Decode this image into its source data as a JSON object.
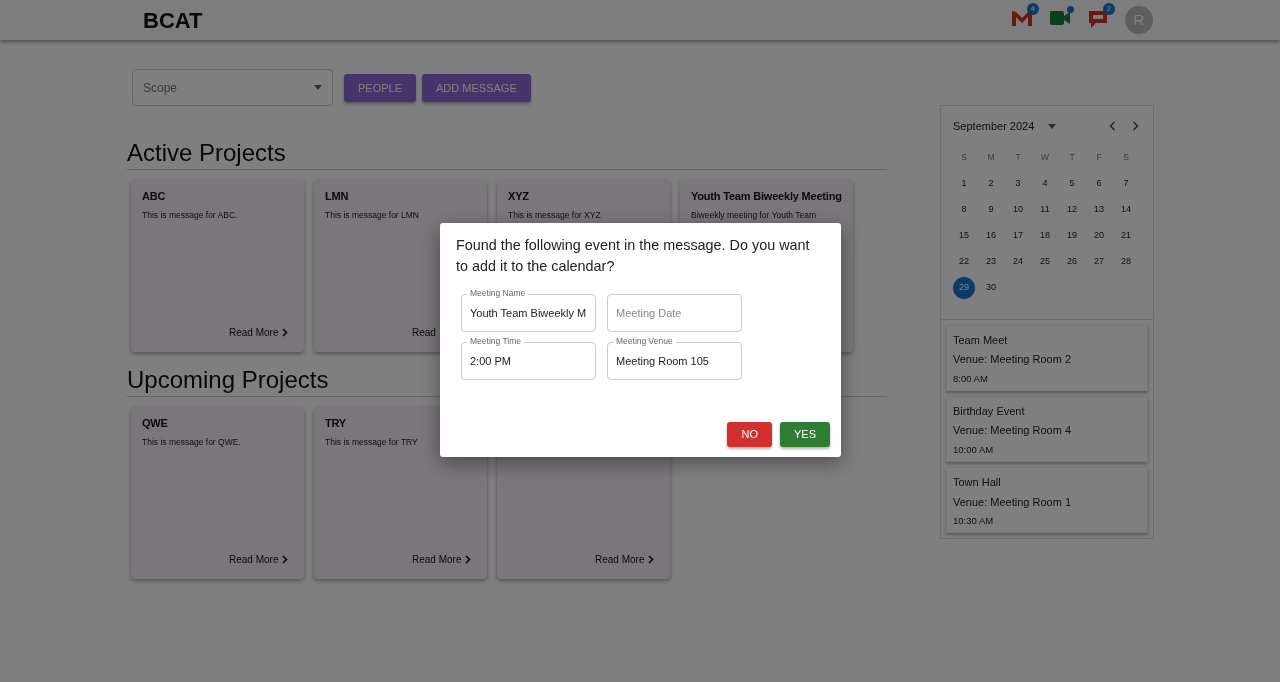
{
  "header": {
    "logo": "BCAT",
    "apps": [
      {
        "kind": "mail",
        "badge": "4"
      },
      {
        "kind": "video"
      },
      {
        "kind": "chat",
        "badge": "2"
      }
    ],
    "avatar": "R"
  },
  "toolbar": {
    "scope": {
      "placeholder": "Scope"
    },
    "buttons": [
      "PEOPLE",
      "ADD MESSAGE"
    ]
  },
  "sections": [
    {
      "title": "Active Projects",
      "cards": [
        {
          "title": "ABC",
          "body": "This is message for ABC.",
          "read_more": "Read More",
          "chevron": true
        },
        {
          "title": "LMN",
          "body": "This is message for LMN",
          "read_more": "Read",
          "chevron": false
        },
        {
          "title": "XYZ",
          "body": "This is message for XYZ"
        },
        {
          "title": "Youth Team Biweekly Meeting",
          "body": "Biweekly meeting for Youth Team"
        }
      ]
    },
    {
      "title": "Upcoming Projects",
      "cards": [
        {
          "title": "QWE",
          "body": "This is message for QWE.",
          "read_more": "Read More",
          "chevron": true
        },
        {
          "title": "TRY",
          "body": "This is message for TRY",
          "read_more": "Read More",
          "chevron": true
        },
        {
          "read_more": "Read More",
          "chevron": true
        }
      ]
    }
  ],
  "calendar": {
    "month": "September 2024",
    "weekdays": [
      "S",
      "M",
      "T",
      "W",
      "T",
      "F",
      "S"
    ],
    "days": [
      {
        "label": "1",
        "selected": false
      },
      {
        "label": "2",
        "selected": false
      },
      {
        "label": "3",
        "selected": false
      },
      {
        "label": "4",
        "selected": false
      },
      {
        "label": "5",
        "selected": false
      },
      {
        "label": "6",
        "selected": false
      },
      {
        "label": "7",
        "selected": false
      },
      {
        "label": "8",
        "selected": false
      },
      {
        "label": "9",
        "selected": false
      },
      {
        "label": "10",
        "selected": false
      },
      {
        "label": "11",
        "selected": false
      },
      {
        "label": "12",
        "selected": false
      },
      {
        "label": "13",
        "selected": false
      },
      {
        "label": "14",
        "selected": false
      },
      {
        "label": "15",
        "selected": false
      },
      {
        "label": "16",
        "selected": false
      },
      {
        "label": "17",
        "selected": false
      },
      {
        "label": "18",
        "selected": false
      },
      {
        "label": "19",
        "selected": false
      },
      {
        "label": "20",
        "selected": false
      },
      {
        "label": "21",
        "selected": false
      },
      {
        "label": "22",
        "selected": false
      },
      {
        "label": "23",
        "selected": false
      },
      {
        "label": "24",
        "selected": false
      },
      {
        "label": "25",
        "selected": false
      },
      {
        "label": "26",
        "selected": false
      },
      {
        "label": "27",
        "selected": false
      },
      {
        "label": "28",
        "selected": false
      },
      {
        "label": "29",
        "selected": true
      },
      {
        "label": "30",
        "selected": false
      }
    ]
  },
  "events": [
    {
      "title": "Team Meet",
      "venue": "Venue: Meeting Room 2",
      "time": "8:00 AM"
    },
    {
      "title": "Birthday Event",
      "venue": "Venue: Meeting Room 4",
      "time": "10:00 AM"
    },
    {
      "title": "Town Hall",
      "venue": "Venue: Meeting Room 1",
      "time": "10:30 AM"
    }
  ],
  "dialog": {
    "message": "Found the following event in the message. Do you want to add it to the calendar?",
    "fields": [
      {
        "label": "Meeting Name",
        "value": "Youth Team Biweekly M"
      },
      {
        "placeholder": "Meeting Date"
      },
      {
        "label": "Meeting Time",
        "value": "2:00 PM"
      },
      {
        "label": "Meeting Venue",
        "value": "Meeting Room 105"
      }
    ],
    "buttons": [
      {
        "kind": "no",
        "label": "NO"
      },
      {
        "kind": "yes",
        "label": "YES"
      }
    ]
  }
}
